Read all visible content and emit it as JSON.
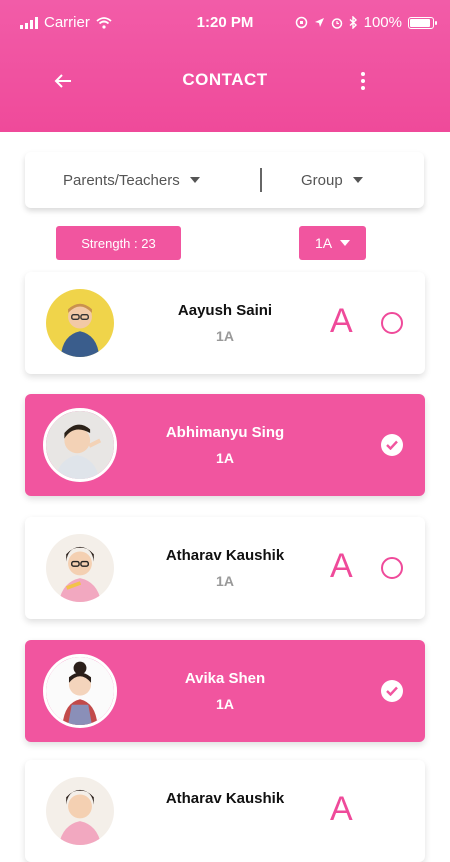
{
  "status": {
    "carrier": "Carrier",
    "time": "1:20 PM",
    "battery": "100%"
  },
  "header": {
    "title": "CONTACT"
  },
  "filters": {
    "audience": "Parents/Teachers",
    "group": "Group"
  },
  "strength": "Strength : 23",
  "class_select": "1A",
  "students": [
    {
      "name": "Aayush Saini",
      "class": "1A",
      "selected": false,
      "attendance": "A"
    },
    {
      "name": "Abhimanyu Sing",
      "class": "1A",
      "selected": true,
      "attendance": ""
    },
    {
      "name": "Atharav Kaushik",
      "class": "1A",
      "selected": false,
      "attendance": "A"
    },
    {
      "name": "Avika Shen",
      "class": "1A",
      "selected": true,
      "attendance": ""
    },
    {
      "name": "Atharav Kaushik",
      "class": "",
      "selected": false,
      "attendance": "A"
    }
  ],
  "colors": {
    "accent": "#f1559f",
    "header": "#ef4a9a"
  }
}
